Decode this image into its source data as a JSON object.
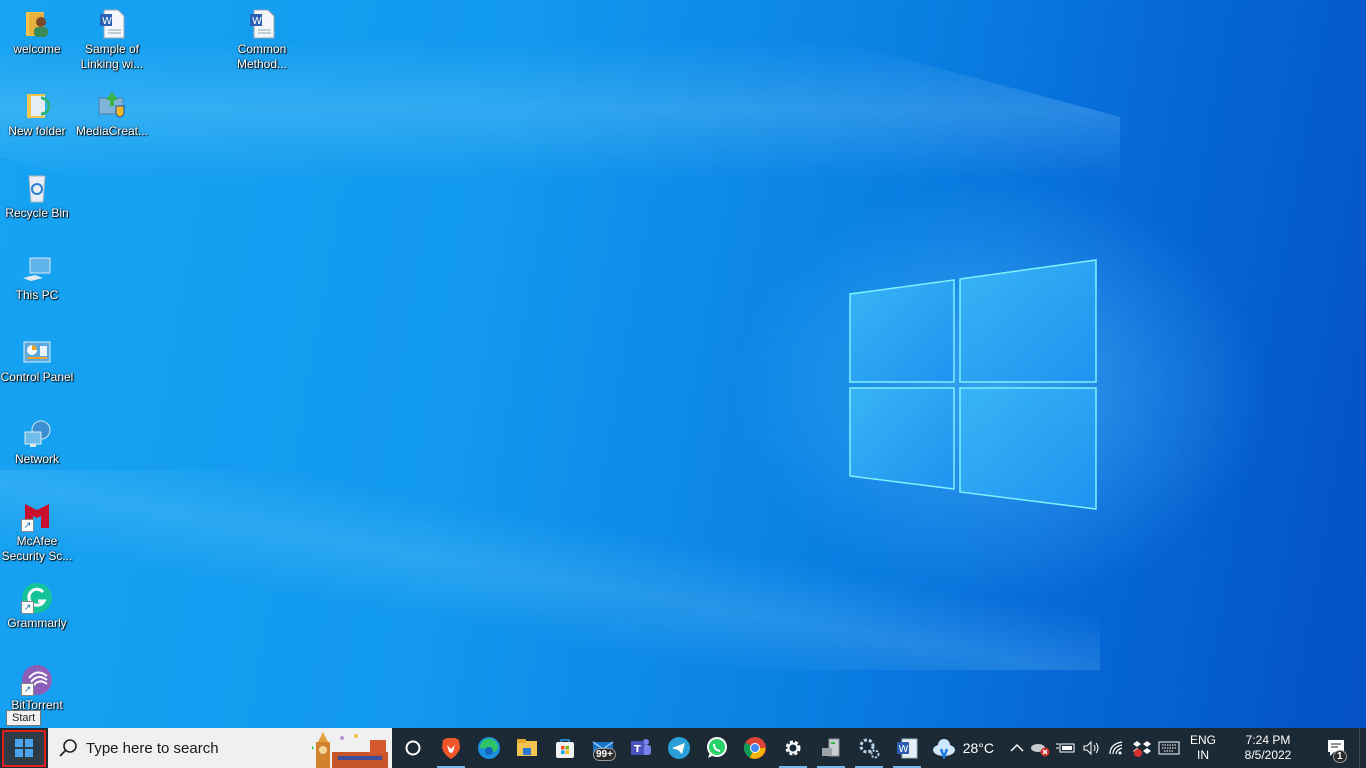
{
  "desktop": {
    "icons": [
      {
        "id": "welcome",
        "label": "welcome",
        "icon": "user-folder-icon"
      },
      {
        "id": "sample-linking",
        "label": "Sample of Linking wi...",
        "icon": "word-document-icon"
      },
      {
        "id": "common-method",
        "label": "Common Method...",
        "icon": "word-document-icon"
      },
      {
        "id": "new-folder",
        "label": "New folder",
        "icon": "folder-icon"
      },
      {
        "id": "media-creation",
        "label": "MediaCreat...",
        "icon": "media-creation-tool-icon"
      },
      {
        "id": "recycle-bin",
        "label": "Recycle Bin",
        "icon": "recycle-bin-icon"
      },
      {
        "id": "this-pc",
        "label": "This PC",
        "icon": "computer-icon"
      },
      {
        "id": "control-panel",
        "label": "Control Panel",
        "icon": "control-panel-icon"
      },
      {
        "id": "network",
        "label": "Network",
        "icon": "network-icon"
      },
      {
        "id": "mcafee",
        "label": "McAfee Security Sc...",
        "icon": "mcafee-icon"
      },
      {
        "id": "grammarly",
        "label": "Grammarly",
        "icon": "grammarly-icon"
      },
      {
        "id": "bittorrent",
        "label": "BitTorrent",
        "icon": "bittorrent-icon"
      }
    ]
  },
  "tooltip": {
    "text": "Start"
  },
  "taskbar": {
    "start_label": "Start",
    "search_placeholder": "Type here to search",
    "pinned": [
      {
        "name": "cortana",
        "icon": "cortana-circle-icon",
        "active": false
      },
      {
        "name": "brave",
        "icon": "brave-browser-icon",
        "active": true
      },
      {
        "name": "edge",
        "icon": "edge-browser-icon",
        "active": false
      },
      {
        "name": "file-explorer",
        "icon": "file-explorer-icon",
        "active": false
      },
      {
        "name": "microsoft-store",
        "icon": "microsoft-store-icon",
        "active": false
      },
      {
        "name": "mail",
        "icon": "mail-icon",
        "active": false,
        "badge": "99+"
      },
      {
        "name": "teams",
        "icon": "teams-icon",
        "active": false
      },
      {
        "name": "telegram",
        "icon": "telegram-icon",
        "active": false
      },
      {
        "name": "whatsapp",
        "icon": "whatsapp-icon",
        "active": false
      },
      {
        "name": "chrome",
        "icon": "chrome-browser-icon",
        "active": false
      },
      {
        "name": "settings",
        "icon": "gear-icon",
        "active": true
      },
      {
        "name": "device-manager",
        "icon": "device-manager-icon",
        "active": true
      },
      {
        "name": "services",
        "icon": "gears-icon",
        "active": true
      },
      {
        "name": "word",
        "icon": "word-icon",
        "active": true
      }
    ],
    "weather": {
      "temp": "28°C",
      "icon": "weather-cloud-icon"
    },
    "tray": {
      "show_hidden_icon": "chevron-up-icon",
      "onedrive_icon": "onedrive-error-icon",
      "battery_icon": "battery-charging-icon",
      "volume_icon": "volume-icon",
      "wifi_icon": "wifi-icon",
      "dropbox_icon": "dropbox-icon",
      "keyboard_icon": "touch-keyboard-icon"
    },
    "language": {
      "line1": "ENG",
      "line2": "IN"
    },
    "clock": {
      "time": "7:24 PM",
      "date": "8/5/2022"
    },
    "notifications": {
      "count": "1"
    }
  },
  "colors": {
    "taskbar": "#1c2a36",
    "start_highlight": "#e0211d",
    "active_indicator": "#76b9ed"
  }
}
